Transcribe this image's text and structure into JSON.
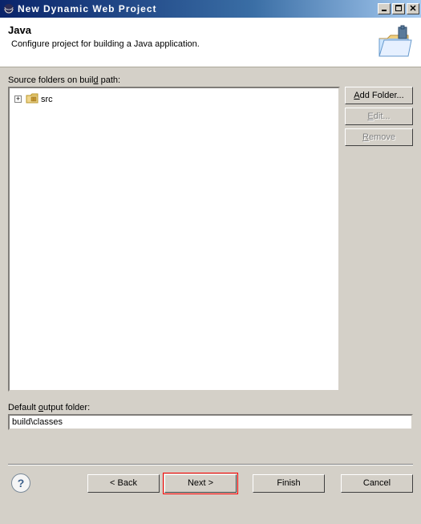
{
  "window": {
    "title": "New Dynamic Web Project"
  },
  "header": {
    "title": "Java",
    "description": "Configure project for building a Java application."
  },
  "sourceFolders": {
    "label_pre": "Source folders on buil",
    "label_mn": "d",
    "label_post": " path:",
    "items": [
      {
        "name": "src"
      }
    ]
  },
  "buttons": {
    "addFolder_pre": "",
    "addFolder_mn": "A",
    "addFolder_post": "dd Folder...",
    "edit_pre": "",
    "edit_mn": "E",
    "edit_post": "dit...",
    "remove_pre": "",
    "remove_mn": "R",
    "remove_post": "emove"
  },
  "outputFolder": {
    "label_pre": "Default ",
    "label_mn": "o",
    "label_post": "utput folder:",
    "value": "build\\classes"
  },
  "wizard": {
    "back": "< Back",
    "next": "Next >",
    "finish": "Finish",
    "cancel": "Cancel"
  },
  "icons": {
    "plus": "+"
  }
}
